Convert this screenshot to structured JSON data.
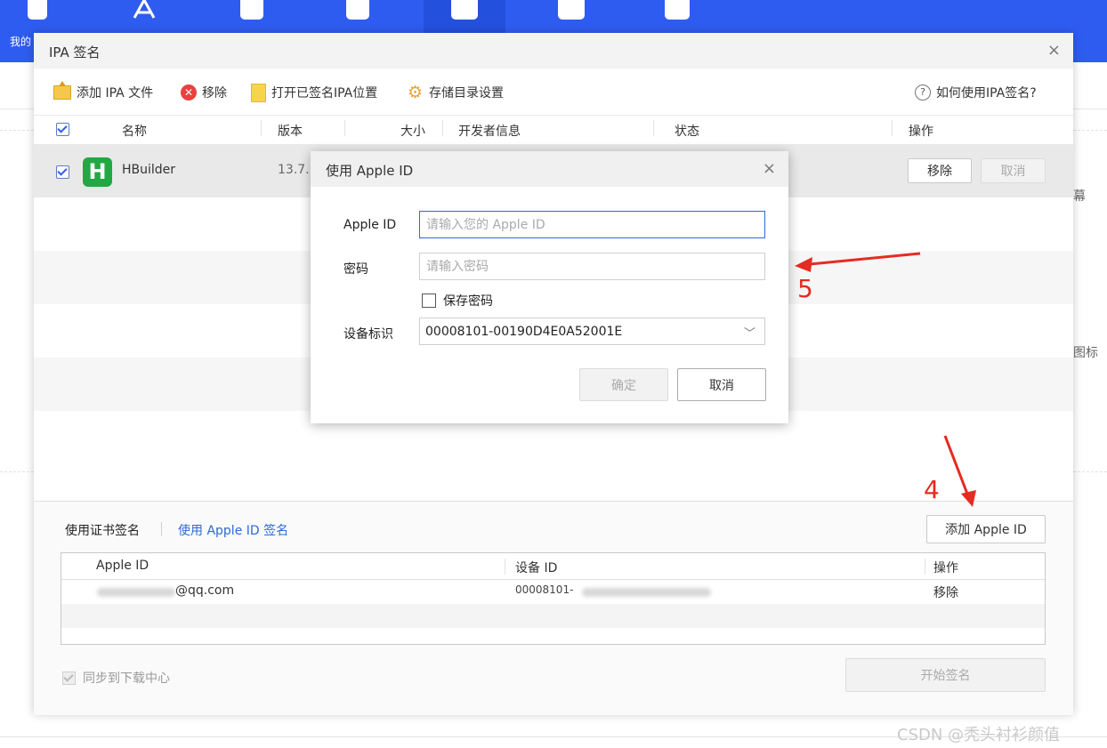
{
  "topbar": {
    "partial_label": "我的",
    "icons": [
      "phone-icon",
      "appstore-icon",
      "music-icon",
      "refresh-icon",
      "toolbox-icon",
      "education-icon",
      "more-apps-icon"
    ],
    "bg_color": "#2f5cf0"
  },
  "background": {
    "side_texts": [
      "幕",
      "图标"
    ]
  },
  "dialog": {
    "title": "IPA 签名",
    "close": "×",
    "toolbar": {
      "add_ipa": "添加 IPA 文件",
      "remove": "移除",
      "open_signed": "打开已签名IPA位置",
      "storage_settings": "存储目录设置",
      "help": "如何使用IPA签名?"
    },
    "columns": [
      "名称",
      "版本",
      "大小",
      "开发者信息",
      "状态",
      "操作"
    ],
    "rows": [
      {
        "name": "HBuilder",
        "version": "13.7.",
        "icon_letter": "H",
        "checked": true,
        "action_remove": "移除",
        "action_cancel": "取消"
      }
    ],
    "bottom": {
      "tab_cert": "使用证书签名",
      "tab_appleid": "使用 Apple ID 签名",
      "add_apple_id": "添加 Apple ID",
      "sub_columns": [
        "Apple ID",
        "设备 ID",
        "操作"
      ],
      "accounts": [
        {
          "apple_id": "@qq.com",
          "device_id": "00008101-",
          "action": "移除"
        }
      ],
      "sync_label": "同步到下载中心",
      "start_sign": "开始签名"
    }
  },
  "modal": {
    "title": "使用 Apple ID",
    "close": "×",
    "apple_id_label": "Apple ID",
    "apple_id_placeholder": "请输入您的 Apple ID",
    "password_label": "密码",
    "password_placeholder": "请输入密码",
    "save_password": "保存密码",
    "device_label": "设备标识",
    "device_value": "00008101-00190D4E0A52001E",
    "confirm": "确定",
    "cancel": "取消"
  },
  "annotations": {
    "step4": "4",
    "step5": "5",
    "color": "#e52b22"
  },
  "watermark": "CSDN @秃头衬衫颜值"
}
